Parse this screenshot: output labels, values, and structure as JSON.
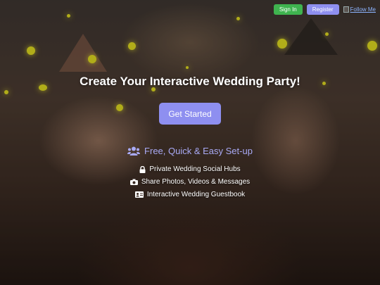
{
  "nav": {
    "signin_label": "Sign In",
    "register_label": "Register",
    "follow_label": "Follow Me"
  },
  "hero": {
    "title": "Create Your Interactive Wedding Party!",
    "cta_label": "Get Started"
  },
  "features": {
    "headline": "Free, Quick & Easy Set-up",
    "headline_icon": "users-icon",
    "items": [
      {
        "icon": "lock-icon",
        "label": "Private Wedding Social Hubs"
      },
      {
        "icon": "camera-icon",
        "label": "Share Photos, Videos & Messages"
      },
      {
        "icon": "id-card-icon",
        "label": "Interactive Wedding Guestbook"
      }
    ]
  },
  "colors": {
    "accent": "#8e8ff0",
    "signin": "#3fb34f",
    "headline": "#a9aaf5",
    "confetti": "#e6e21e"
  }
}
